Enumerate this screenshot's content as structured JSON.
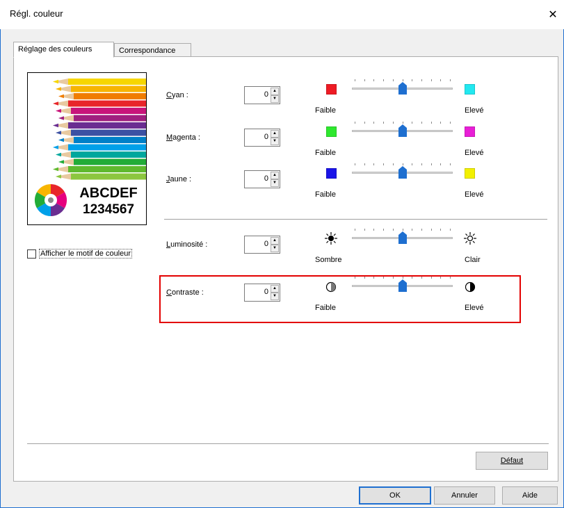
{
  "window": {
    "title": "Régl. couleur",
    "close_glyph": "✕"
  },
  "tabs": [
    {
      "label": "Réglage des couleurs"
    },
    {
      "label": "Correspondance"
    }
  ],
  "preview": {
    "line1": "ABCDEF",
    "line2": "1234567"
  },
  "checkbox": {
    "label": "Afficher le motif de couleur",
    "checked": false
  },
  "controls": [
    {
      "label": "Cyan :",
      "value": "0",
      "left_label": "Faible",
      "right_label": "Elevé",
      "left_color": "#ee1b24",
      "right_color": "#22e8f0",
      "left_icon": "red-square-icon",
      "right_icon": "cyan-square-icon",
      "level": 0.5
    },
    {
      "label": "Magenta :",
      "value": "0",
      "left_label": "Faible",
      "right_label": "Elevé",
      "left_color": "#2ee82e",
      "right_color": "#e81fd6",
      "left_icon": "green-square-icon",
      "right_icon": "magenta-square-icon",
      "level": 0.5
    },
    {
      "label": "Jaune :",
      "value": "0",
      "left_label": "Faible",
      "right_label": "Elevé",
      "left_color": "#1a14e8",
      "right_color": "#f2f000",
      "left_icon": "blue-square-icon",
      "right_icon": "yellow-square-icon",
      "level": 0.5
    },
    {
      "label": "Luminosité :",
      "value": "0",
      "left_label": "Sombre",
      "right_label": "Clair",
      "left_icon": "sun-dark-icon",
      "right_icon": "sun-light-icon",
      "level": 0.5
    },
    {
      "label": "Contraste :",
      "value": "0",
      "left_label": "Faible",
      "right_label": "Elevé",
      "left_icon": "contrast-low-icon",
      "right_icon": "contrast-high-icon",
      "level": 0.5
    }
  ],
  "buttons": {
    "default": "Défaut",
    "ok": "OK",
    "cancel": "Annuler",
    "help": "Aide"
  },
  "colors": {
    "highlight": "#e30000",
    "slider_thumb": "#1e6fd0",
    "window_border": "#1e6fd0"
  }
}
